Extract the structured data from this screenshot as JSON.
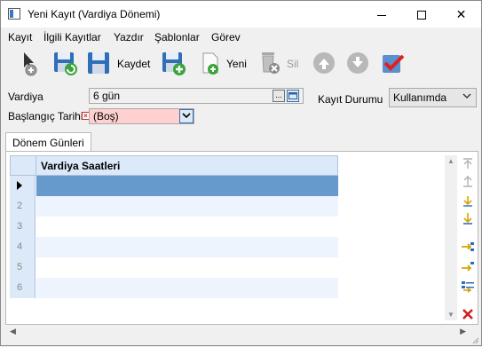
{
  "window": {
    "title": "Yeni Kayıt (Vardiya Dönemi)",
    "minimize_symbol": "",
    "maximize_symbol": "",
    "close_symbol": "✕"
  },
  "menu": {
    "items": [
      "Kayıt",
      "İlgili Kayıtlar",
      "Yazdır",
      "Şablonlar",
      "Görev"
    ]
  },
  "toolbar": {
    "save_label": "Kaydet",
    "new_label": "Yeni",
    "delete_label": "Sil"
  },
  "form": {
    "vardiya_label": "Vardiya",
    "vardiya_value": "6 gün",
    "vardiya_browse": "...",
    "baslangic_label": "Başlangıç Tarihi",
    "baslangic_value": "(Boş)",
    "kayit_durumu_label": "Kayıt Durumu",
    "kayit_durumu_value": "Kullanımda"
  },
  "tabs": {
    "donem_gunleri": "Dönem Günleri"
  },
  "grid": {
    "column_header": "Vardiya Saatleri",
    "rows": [
      {
        "num": "",
        "value": "",
        "selected": true
      },
      {
        "num": "2",
        "value": ""
      },
      {
        "num": "3",
        "value": ""
      },
      {
        "num": "4",
        "value": ""
      },
      {
        "num": "5",
        "value": ""
      },
      {
        "num": "6",
        "value": ""
      }
    ]
  },
  "colors": {
    "accent": "#6699cc",
    "grid_header": "#dce9f8",
    "required_field": "#ffd0d0",
    "delete_red": "#d02020"
  }
}
